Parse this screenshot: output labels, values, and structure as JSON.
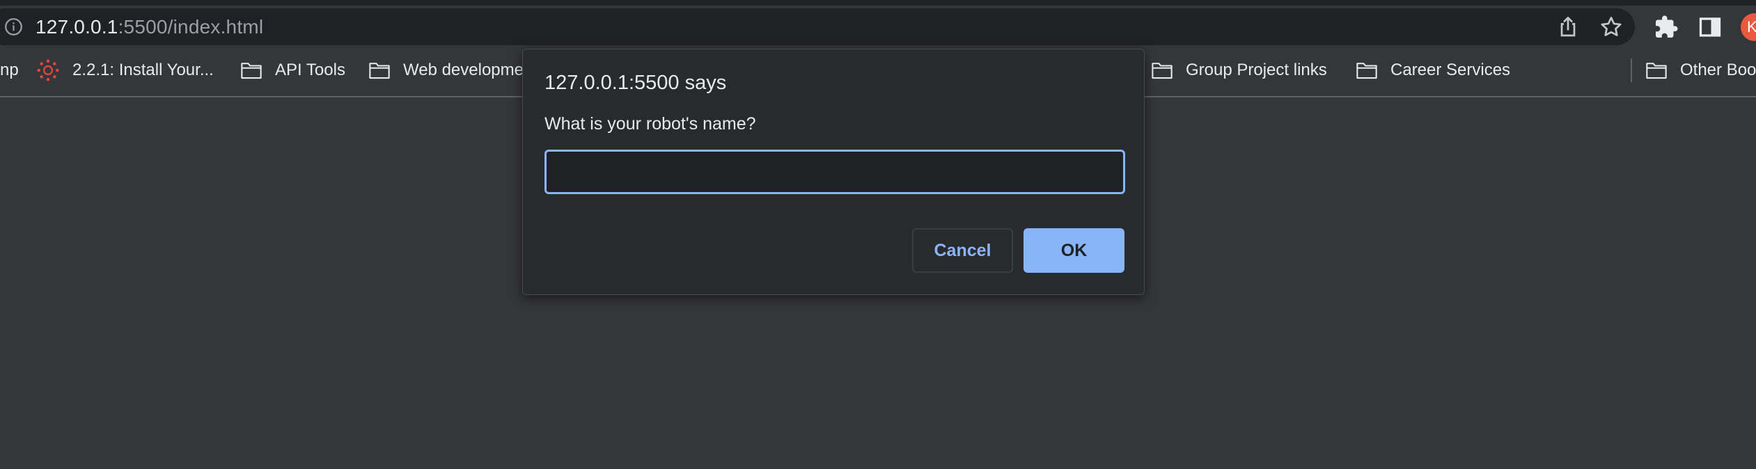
{
  "browser": {
    "url_host": "127.0.0.1",
    "url_path": ":5500/index.html"
  },
  "profile": {
    "initial": "K",
    "color": "#e8593d"
  },
  "bookmarks": {
    "partial_left": "np",
    "items": [
      {
        "label": "2.2.1: Install Your...",
        "icon": "canvas-logo-icon"
      },
      {
        "label": "API Tools",
        "icon": "folder-icon"
      },
      {
        "label": "Web developme",
        "icon": "folder-icon"
      },
      {
        "label": "Group Project links",
        "icon": "folder-icon"
      },
      {
        "label": "Career Services",
        "icon": "folder-icon"
      }
    ],
    "other": {
      "label": "Other Boo",
      "icon": "folder-icon"
    }
  },
  "dialog": {
    "title": "127.0.0.1:5500 says",
    "message": "What is your robot's name?",
    "input_value": "",
    "cancel_label": "Cancel",
    "ok_label": "OK"
  },
  "colors": {
    "accent": "#8ab4f8",
    "background": "#35363a",
    "dialog_background": "#292a2d",
    "omnibox_background": "#202124"
  }
}
